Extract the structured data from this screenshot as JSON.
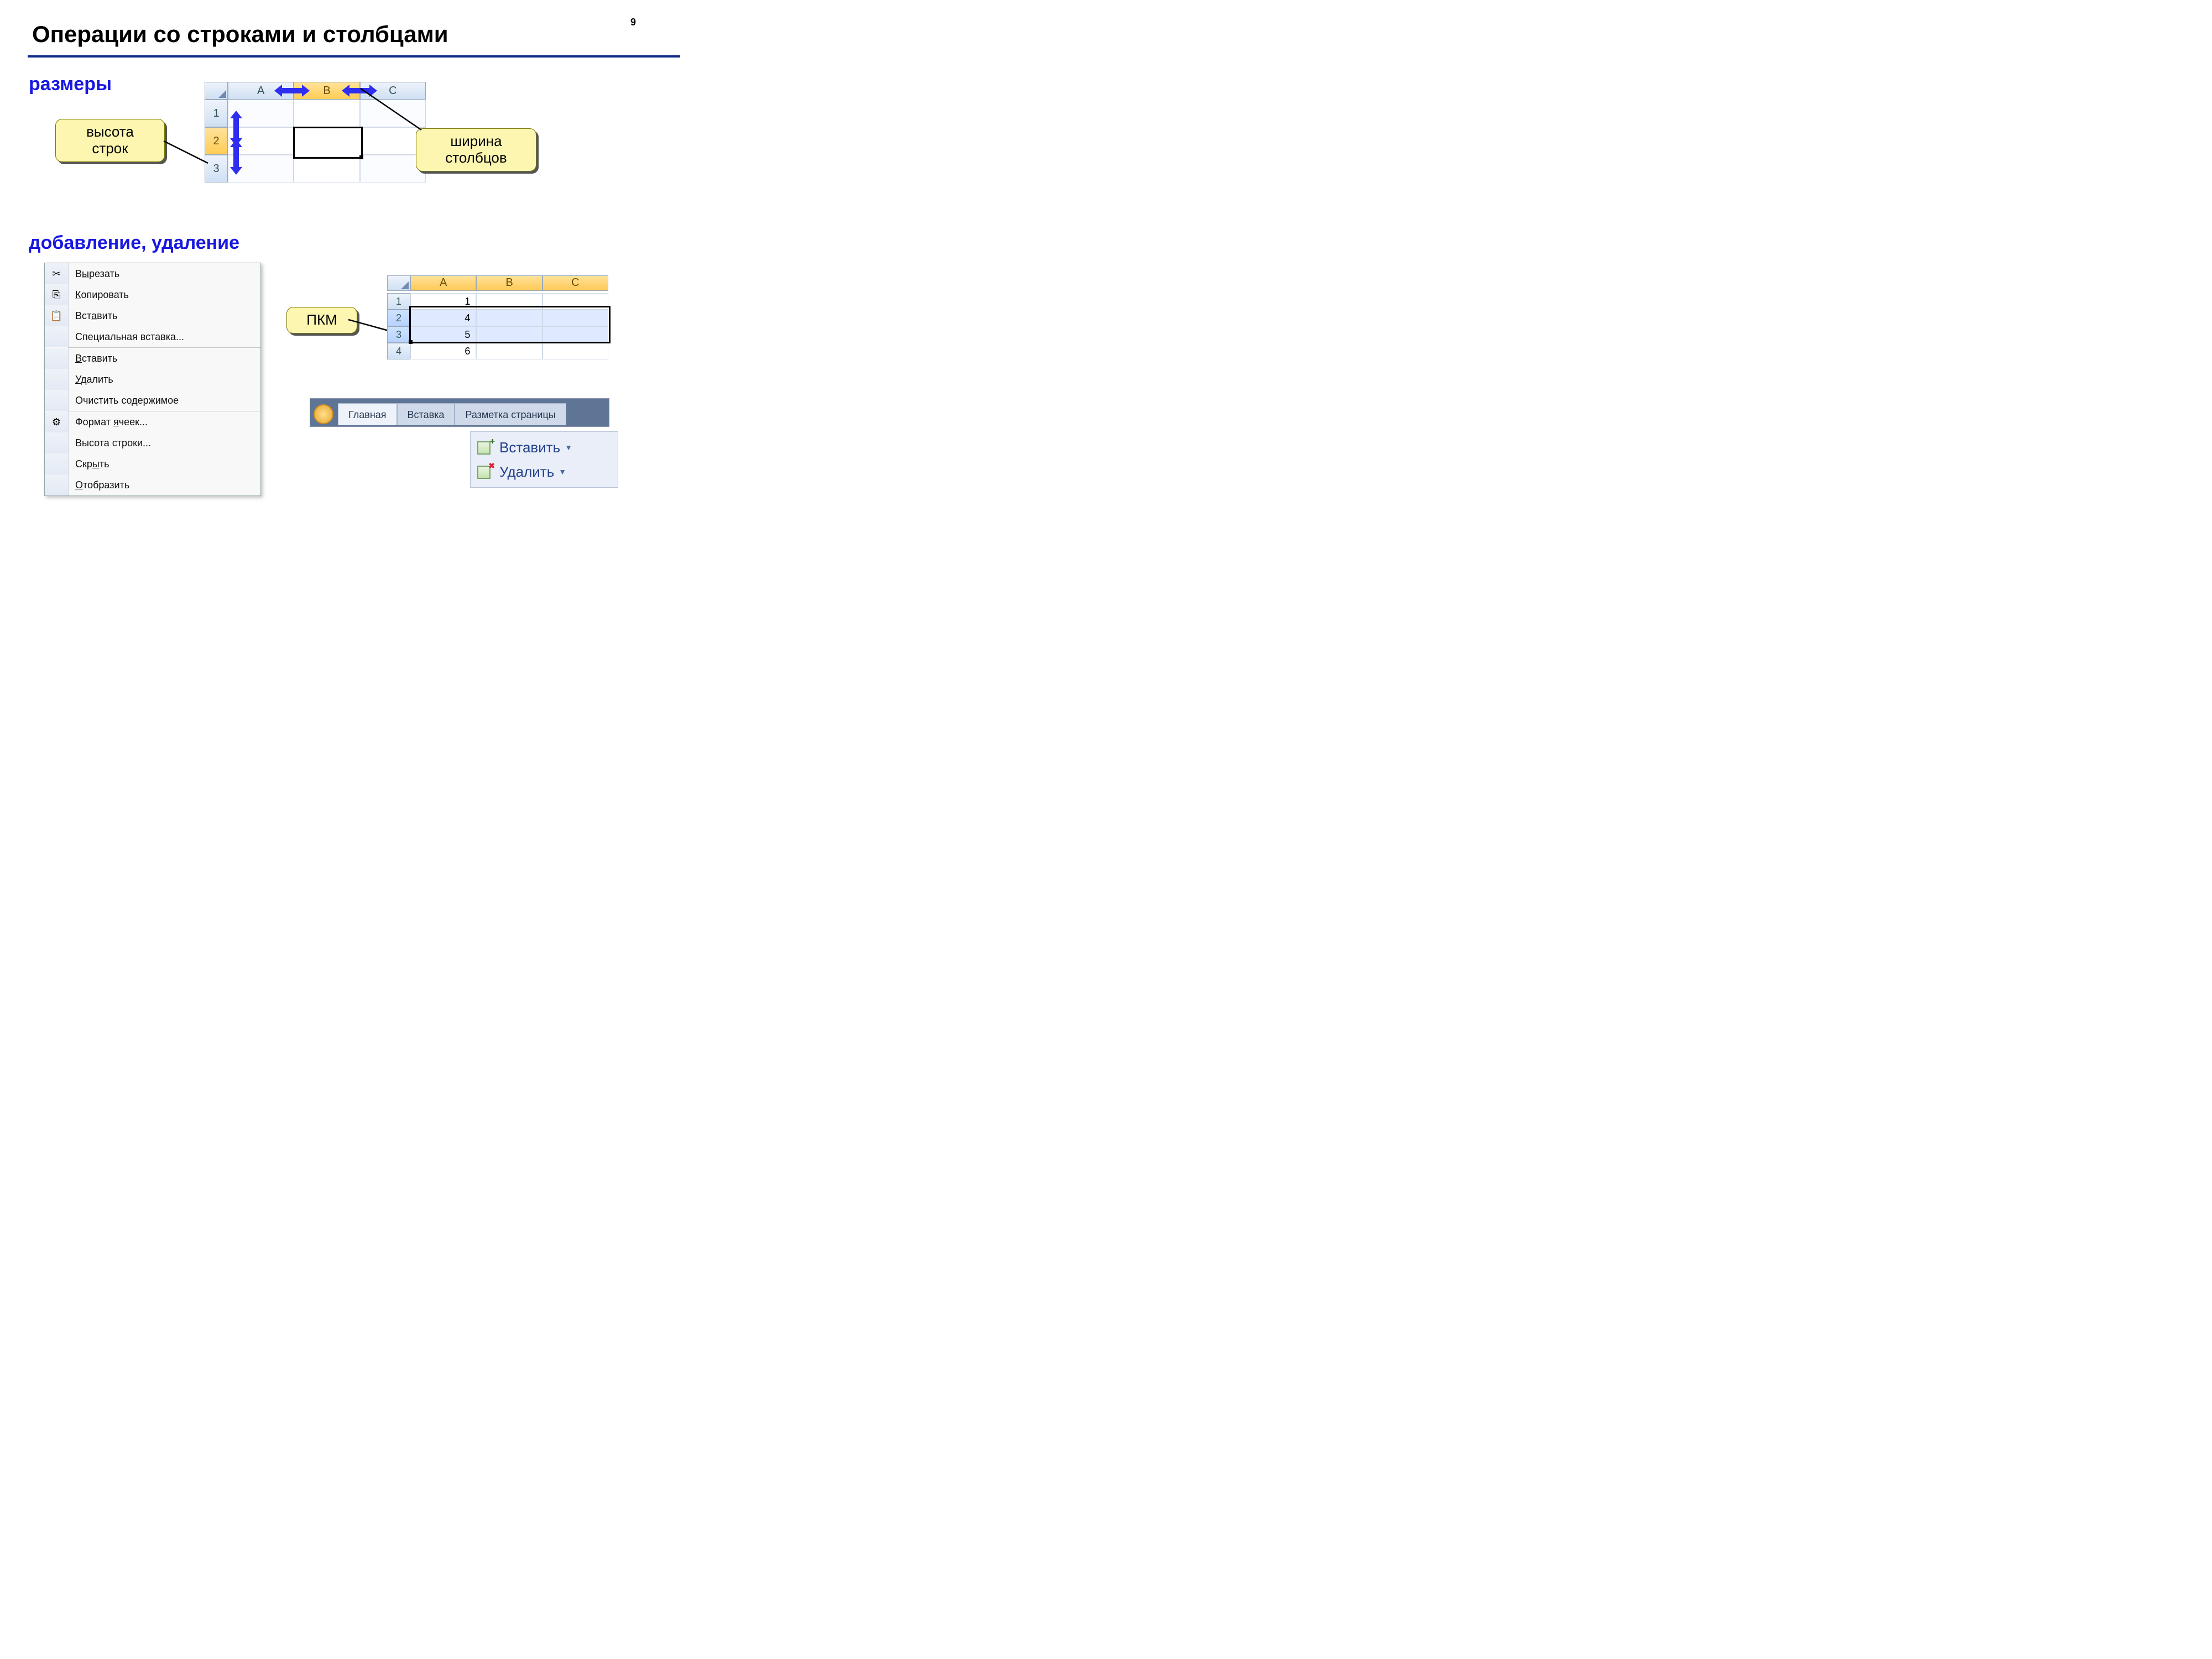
{
  "page_number": "9",
  "title": "Операции со строками и столбцами",
  "section_sizes": "размеры",
  "section_add_del": "добавление, удаление",
  "callouts": {
    "row_height": "высота\nстрок",
    "col_width": "ширина\nстолбцов",
    "rmb": "ПКМ"
  },
  "grid1": {
    "cols": [
      "A",
      "B",
      "C"
    ],
    "rows": [
      "1",
      "2",
      "3"
    ],
    "selected_col": "B",
    "selected_row": "2"
  },
  "context_menu": [
    {
      "icon": "cut",
      "label": "Вырезать",
      "u": 1
    },
    {
      "icon": "copy",
      "label": "Копировать",
      "u": 0
    },
    {
      "icon": "paste",
      "label": "Вставить",
      "u": 3
    },
    {
      "icon": "",
      "label": "Специальная вставка...",
      "u": -1,
      "sep_after": true
    },
    {
      "icon": "",
      "label": "Вставить",
      "u": 0
    },
    {
      "icon": "",
      "label": "Удалить",
      "u": 0
    },
    {
      "icon": "",
      "label": "Очистить содержимое",
      "u": -1,
      "sep_after": true
    },
    {
      "icon": "format",
      "label": "Формат ячеек...",
      "u": 7
    },
    {
      "icon": "",
      "label": "Высота строки...",
      "u": -1
    },
    {
      "icon": "",
      "label": "Скрыть",
      "u": 3
    },
    {
      "icon": "",
      "label": "Отобразить",
      "u": 0
    }
  ],
  "grid2": {
    "cols": [
      "A",
      "B",
      "C"
    ],
    "rows": [
      {
        "n": "1",
        "a": "1"
      },
      {
        "n": "2",
        "a": "4",
        "sel": true
      },
      {
        "n": "3",
        "a": "5",
        "sel": true
      },
      {
        "n": "4",
        "a": "6"
      }
    ]
  },
  "ribbon_tabs": [
    "Главная",
    "Вставка",
    "Разметка страницы"
  ],
  "ribbon_active": 0,
  "ribbon_buttons": {
    "insert": "Вставить",
    "delete": "Удалить"
  }
}
